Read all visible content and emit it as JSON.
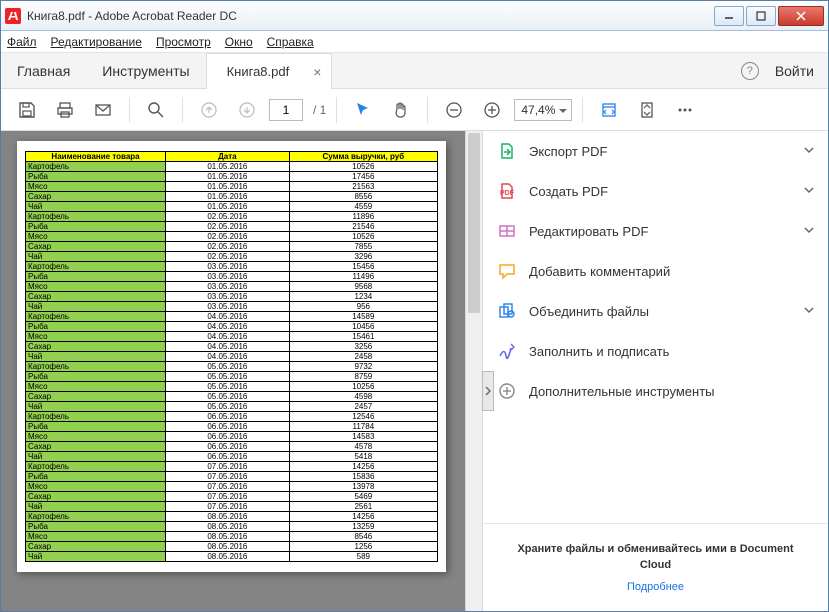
{
  "window": {
    "title": "Книга8.pdf - Adobe Acrobat Reader DC"
  },
  "menu": {
    "file": "Файл",
    "edit": "Редактирование",
    "view": "Просмотр",
    "window": "Окно",
    "help": "Справка"
  },
  "tabs": {
    "home": "Главная",
    "tools": "Инструменты",
    "doc": "Книга8.pdf",
    "signin": "Войти"
  },
  "toolbar": {
    "page_current": "1",
    "page_total": "/ 1",
    "zoom": "47,4%"
  },
  "side": {
    "items": [
      {
        "label": "Экспорт PDF",
        "icon": "export",
        "color": "#1db36a",
        "expand": true
      },
      {
        "label": "Создать PDF",
        "icon": "create",
        "color": "#e34850",
        "expand": true
      },
      {
        "label": "Редактировать PDF",
        "icon": "edit",
        "color": "#d272c4",
        "expand": true
      },
      {
        "label": "Добавить комментарий",
        "icon": "comment",
        "color": "#f5a623",
        "expand": false
      },
      {
        "label": "Объединить файлы",
        "icon": "combine",
        "color": "#2680eb",
        "expand": true
      },
      {
        "label": "Заполнить и подписать",
        "icon": "sign",
        "color": "#6767ec",
        "expand": false
      },
      {
        "label": "Дополнительные инструменты",
        "icon": "more",
        "color": "#888888",
        "expand": false
      }
    ],
    "footer": {
      "text": "Храните файлы и обменивайтесь ими в Document Cloud",
      "link": "Подробнее"
    }
  },
  "chart_data": {
    "type": "table",
    "title": "",
    "columns": [
      "Наименование товара",
      "Дата",
      "Сумма выручки, руб"
    ],
    "rows": [
      [
        "Картофель",
        "01.05.2016",
        "10526"
      ],
      [
        "Рыба",
        "01.05.2016",
        "17456"
      ],
      [
        "Мясо",
        "01.05.2016",
        "21563"
      ],
      [
        "Сахар",
        "01.05.2016",
        "8556"
      ],
      [
        "Чай",
        "01.05.2016",
        "4559"
      ],
      [
        "Картофель",
        "02.05.2016",
        "11896"
      ],
      [
        "Рыба",
        "02.05.2016",
        "21546"
      ],
      [
        "Мясо",
        "02.05.2016",
        "10526"
      ],
      [
        "Сахар",
        "02.05.2016",
        "7855"
      ],
      [
        "Чай",
        "02.05.2016",
        "3296"
      ],
      [
        "Картофель",
        "03.05.2016",
        "15456"
      ],
      [
        "Рыба",
        "03.05.2016",
        "11496"
      ],
      [
        "Мясо",
        "03.05.2016",
        "9568"
      ],
      [
        "Сахар",
        "03.05.2016",
        "1234"
      ],
      [
        "Чай",
        "03.05.2016",
        "956"
      ],
      [
        "Картофель",
        "04.05.2016",
        "14589"
      ],
      [
        "Рыба",
        "04.05.2016",
        "10456"
      ],
      [
        "Мясо",
        "04.05.2016",
        "15461"
      ],
      [
        "Сахар",
        "04.05.2016",
        "3256"
      ],
      [
        "Чай",
        "04.05.2016",
        "2458"
      ],
      [
        "Картофель",
        "05.05.2016",
        "9732"
      ],
      [
        "Рыба",
        "05.05.2016",
        "8759"
      ],
      [
        "Мясо",
        "05.05.2016",
        "10256"
      ],
      [
        "Сахар",
        "05.05.2016",
        "4598"
      ],
      [
        "Чай",
        "05.05.2016",
        "2457"
      ],
      [
        "Картофель",
        "06.05.2016",
        "12546"
      ],
      [
        "Рыба",
        "06.05.2016",
        "11784"
      ],
      [
        "Мясо",
        "06.05.2016",
        "14583"
      ],
      [
        "Сахар",
        "06.05.2016",
        "4578"
      ],
      [
        "Чай",
        "06.05.2016",
        "5418"
      ],
      [
        "Картофель",
        "07.05.2016",
        "14256"
      ],
      [
        "Рыба",
        "07.05.2016",
        "15836"
      ],
      [
        "Мясо",
        "07.05.2016",
        "13978"
      ],
      [
        "Сахар",
        "07.05.2016",
        "5469"
      ],
      [
        "Чай",
        "07.05.2016",
        "2561"
      ],
      [
        "Картофель",
        "08.05.2016",
        "14256"
      ],
      [
        "Рыба",
        "08.05.2016",
        "13259"
      ],
      [
        "Мясо",
        "08.05.2016",
        "8546"
      ],
      [
        "Сахар",
        "08.05.2016",
        "1256"
      ],
      [
        "Чай",
        "08.05.2016",
        "589"
      ]
    ]
  }
}
